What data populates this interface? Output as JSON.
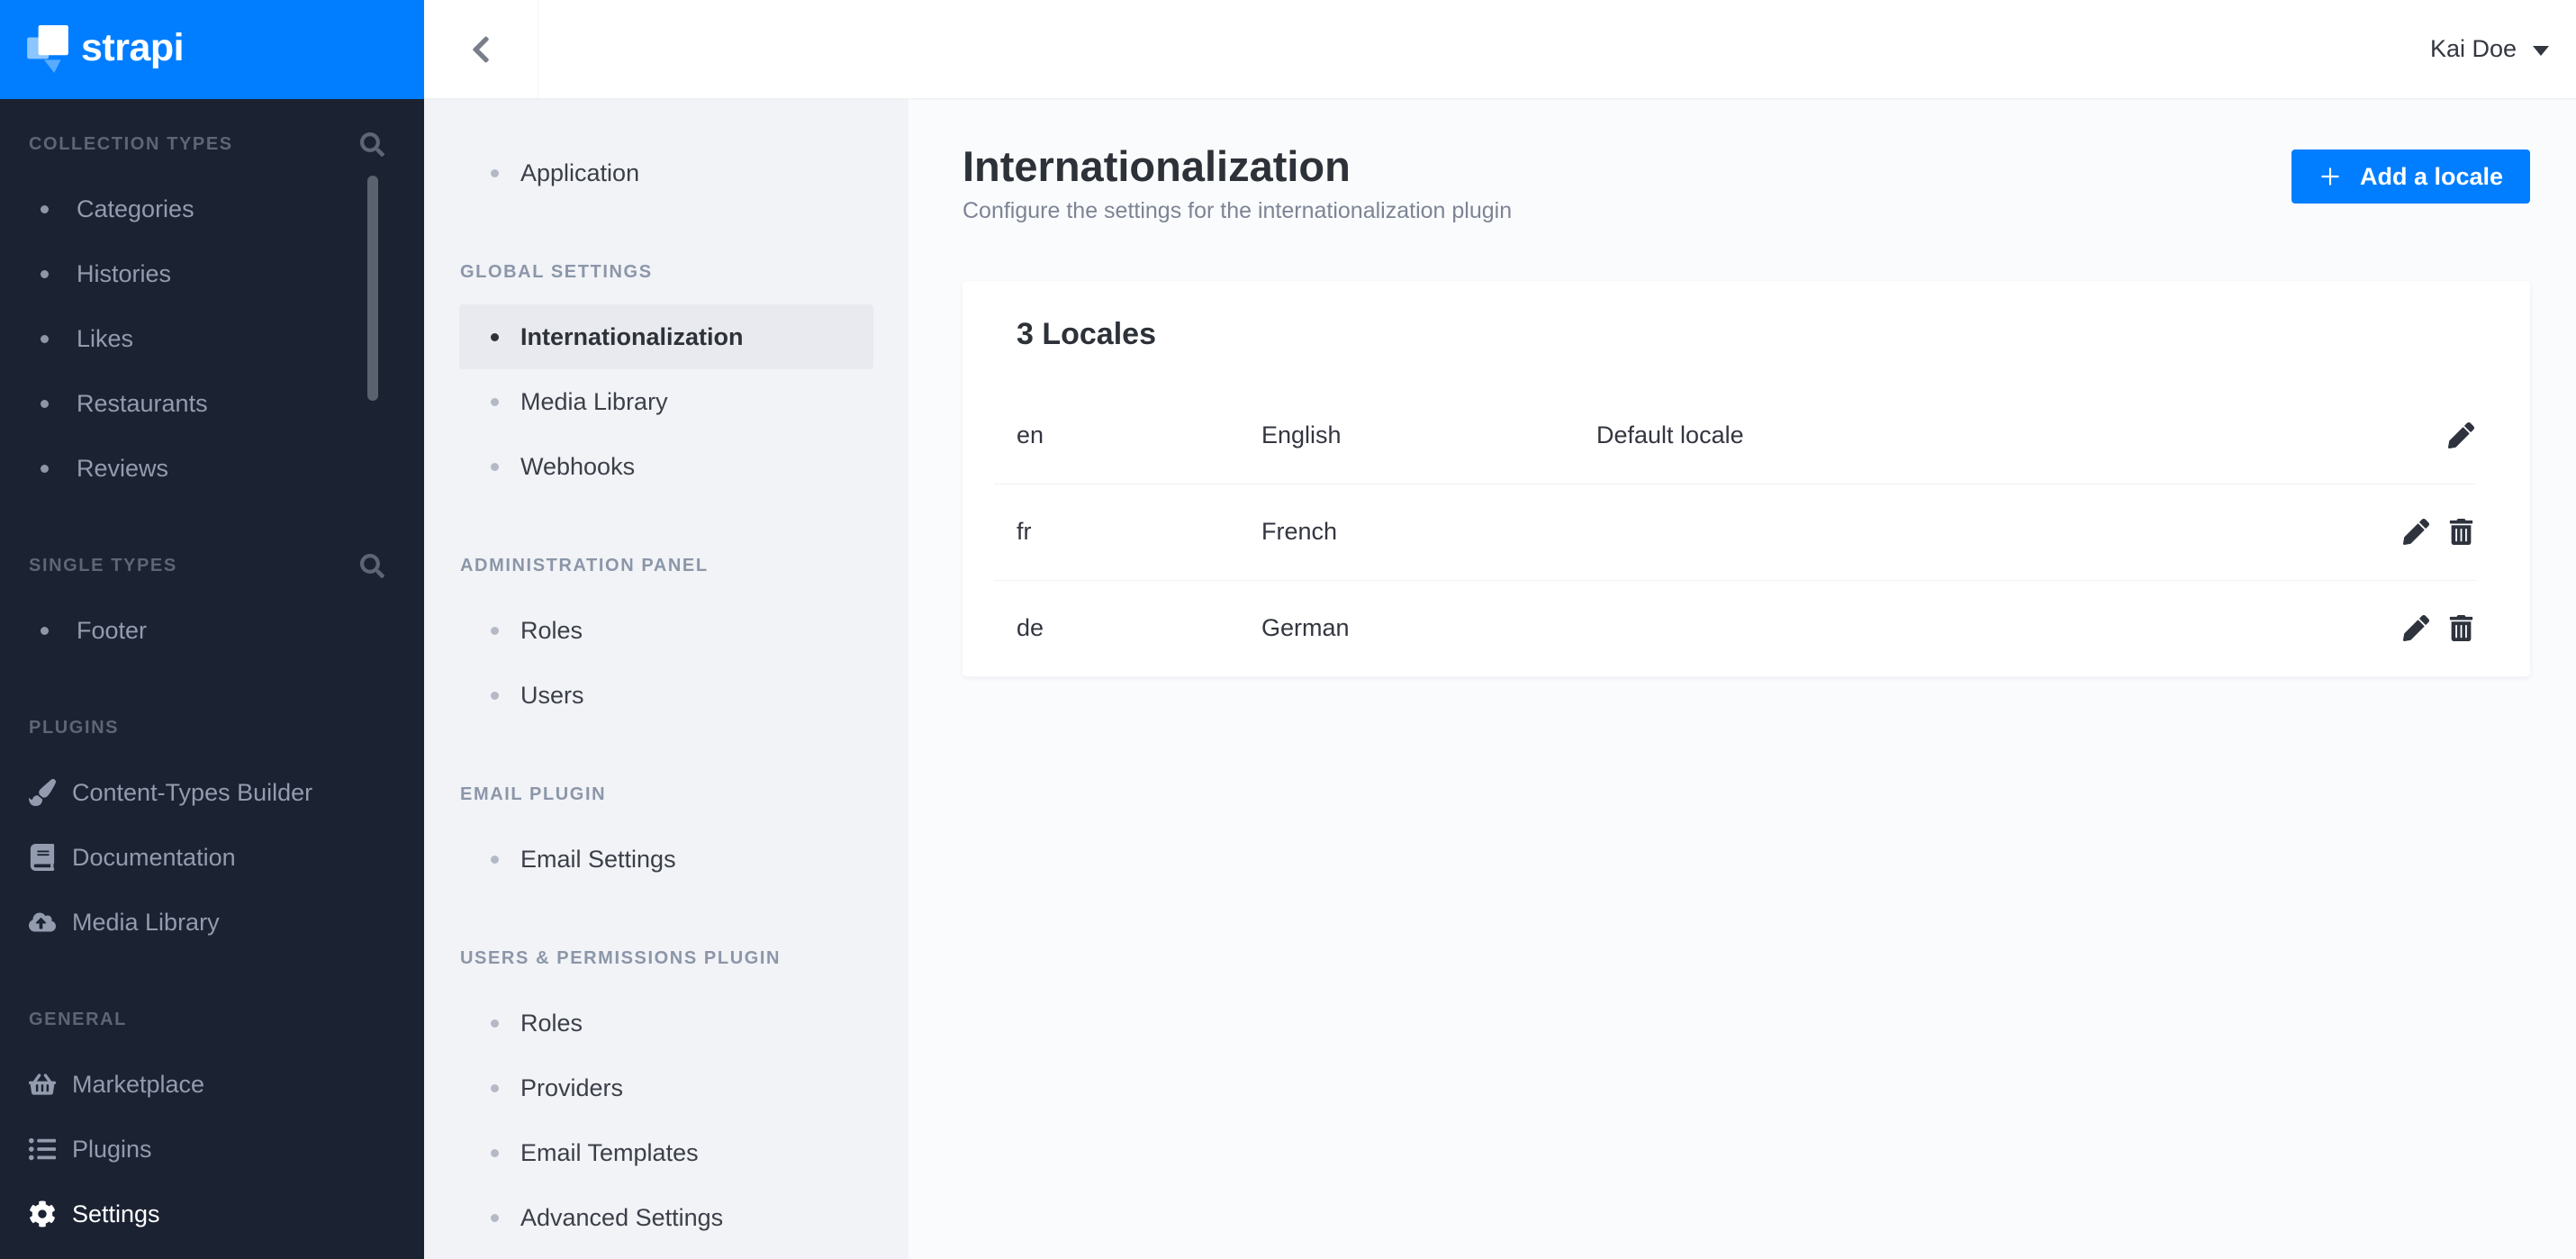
{
  "brand": {
    "name": "strapi",
    "accent_color": "#007eff",
    "sidebar_color": "#1b2232"
  },
  "topbar": {
    "back_icon": "chevron-left",
    "user_name": "Kai Doe",
    "user_caret_icon": "caret-down"
  },
  "main_sidebar": {
    "scrollbar_visible": true,
    "sections": [
      {
        "label": "COLLECTION TYPES",
        "search_icon": "search",
        "items": [
          {
            "label": "Categories",
            "icon": "dot"
          },
          {
            "label": "Histories",
            "icon": "dot"
          },
          {
            "label": "Likes",
            "icon": "dot"
          },
          {
            "label": "Restaurants",
            "icon": "dot"
          },
          {
            "label": "Reviews",
            "icon": "dot"
          }
        ]
      },
      {
        "label": "SINGLE TYPES",
        "search_icon": "search",
        "items": [
          {
            "label": "Footer",
            "icon": "dot"
          }
        ]
      },
      {
        "label": "PLUGINS",
        "search_icon": null,
        "items": [
          {
            "label": "Content-Types Builder",
            "icon": "paint-brush"
          },
          {
            "label": "Documentation",
            "icon": "book"
          },
          {
            "label": "Media Library",
            "icon": "cloud-upload"
          }
        ]
      },
      {
        "label": "GENERAL",
        "search_icon": null,
        "items": [
          {
            "label": "Marketplace",
            "icon": "shopping-basket"
          },
          {
            "label": "Plugins",
            "icon": "list"
          },
          {
            "label": "Settings",
            "icon": "gear",
            "active": true
          }
        ]
      }
    ]
  },
  "settings_sidebar": {
    "sections": [
      {
        "label": null,
        "items": [
          {
            "label": "Application"
          }
        ]
      },
      {
        "label": "GLOBAL SETTINGS",
        "items": [
          {
            "label": "Internationalization",
            "active": true
          },
          {
            "label": "Media Library"
          },
          {
            "label": "Webhooks"
          }
        ]
      },
      {
        "label": "ADMINISTRATION PANEL",
        "items": [
          {
            "label": "Roles"
          },
          {
            "label": "Users"
          }
        ]
      },
      {
        "label": "EMAIL PLUGIN",
        "items": [
          {
            "label": "Email Settings"
          }
        ]
      },
      {
        "label": "USERS & PERMISSIONS PLUGIN",
        "items": [
          {
            "label": "Roles"
          },
          {
            "label": "Providers"
          },
          {
            "label": "Email Templates"
          },
          {
            "label": "Advanced Settings"
          }
        ]
      }
    ]
  },
  "main": {
    "title": "Internationalization",
    "subtitle": "Configure the settings for the internationalization plugin",
    "add_button": {
      "label": "Add a locale",
      "icon": "plus"
    },
    "locales_card": {
      "title": "3 Locales",
      "rows": [
        {
          "code": "en",
          "name": "English",
          "note": "Default locale",
          "actions": [
            "edit"
          ]
        },
        {
          "code": "fr",
          "name": "French",
          "note": "",
          "actions": [
            "edit",
            "delete"
          ]
        },
        {
          "code": "de",
          "name": "German",
          "note": "",
          "actions": [
            "edit",
            "delete"
          ]
        }
      ]
    }
  }
}
